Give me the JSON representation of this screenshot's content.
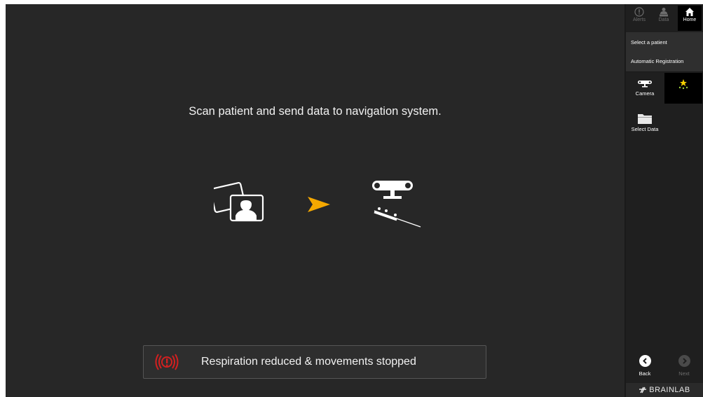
{
  "main": {
    "instruction": "Scan patient and send data to navigation system.",
    "workflow": {
      "source_icon": "patient-images-icon",
      "arrow_icon": "arrow-right-icon",
      "target_icon": "navigation-camera-pointer-icon",
      "arrow_color": "#f5a800"
    },
    "alert": {
      "icon": "alarm-icon",
      "icon_color": "#d32020",
      "text": "Respiration reduced & movements stopped"
    }
  },
  "sidebar": {
    "nav": [
      {
        "label": "Alerts",
        "icon": "alert-icon",
        "active": false
      },
      {
        "label": "Data",
        "icon": "data-icon",
        "active": false
      },
      {
        "label": "Home",
        "icon": "home-icon",
        "active": true
      }
    ],
    "menu": [
      {
        "label": "Select a patient"
      },
      {
        "label": "Automatic Registration"
      }
    ],
    "tools": [
      {
        "label": "Camera",
        "icon": "camera-icon"
      },
      {
        "label": "",
        "icon": "registration-points-icon"
      },
      {
        "label": "Select Data",
        "icon": "folder-icon"
      }
    ],
    "back_label": "Back",
    "next_label": "Next",
    "brand": "BRAINLAB"
  }
}
